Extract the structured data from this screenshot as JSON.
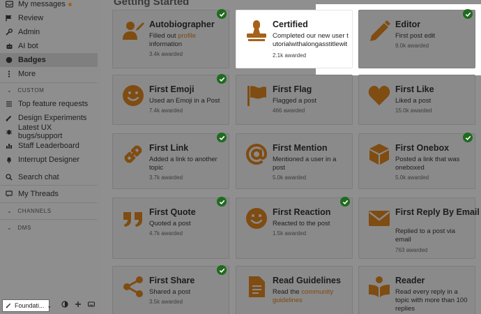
{
  "colors": {
    "accent": "#a7611a",
    "badge_icon": "#7f4c12",
    "check": "#1f6b1f"
  },
  "sidebar": {
    "items": [
      {
        "label": "My messages",
        "icon": "inbox-icon",
        "has_dot": true
      },
      {
        "label": "Review",
        "icon": "flag-icon"
      },
      {
        "label": "Admin",
        "icon": "wrench-icon"
      },
      {
        "label": "AI bot",
        "icon": "robot-icon"
      },
      {
        "label": "Badges",
        "icon": "certificate-icon",
        "active": true
      },
      {
        "label": "More",
        "icon": "more-vertical-icon"
      }
    ],
    "custom_header": "CUSTOM",
    "custom_items": [
      {
        "label": "Top feature requests",
        "icon": "list-icon"
      },
      {
        "label": "Design Experiments",
        "icon": "paint-icon"
      },
      {
        "label": "Latest UX bugs/support",
        "icon": "bug-icon"
      },
      {
        "label": "Staff Leaderboard",
        "icon": "chart-icon"
      },
      {
        "label": "Interrupt Designer",
        "icon": "bell-icon"
      }
    ],
    "search_chat": "Search chat",
    "my_threads": "My Threads",
    "channels_header": "CHANNELS",
    "dms_header": "DMS",
    "footer": {
      "theme_label": "Foundati..."
    }
  },
  "main": {
    "title": "Getting Started",
    "badges": [
      {
        "name": "Autobiographer",
        "desc_before": "Filled out ",
        "desc_link": "profile",
        "desc_after": " information",
        "count": "3.4k awarded"
      },
      {
        "name": "Certified",
        "desc": "Completed our new user tutorialwithalongasstitlewithou",
        "count": "2.1k awarded"
      },
      {
        "name": "Editor",
        "desc": "First post edit",
        "count": "9.0k awarded"
      },
      {
        "name": "First Emoji",
        "desc": "Used an Emoji in a Post",
        "count": "7.4k awarded"
      },
      {
        "name": "First Flag",
        "desc": "Flagged a post",
        "count": "466 awarded"
      },
      {
        "name": "First Like",
        "desc": "Liked a post",
        "count": "15.0k awarded"
      },
      {
        "name": "First Link",
        "desc": "Added a link to another topic",
        "count": "3.7k awarded"
      },
      {
        "name": "First Mention",
        "desc": "Mentioned a user in a post",
        "count": "5.0k awarded"
      },
      {
        "name": "First Onebox",
        "desc": "Posted a link that was oneboxed",
        "count": "5.0k awarded"
      },
      {
        "name": "First Quote",
        "desc": "Quoted a post",
        "count": "4.7k awarded"
      },
      {
        "name": "First Reaction",
        "desc": "Reacted to the post",
        "count": "1.5k awarded"
      },
      {
        "name": "First Reply By Email",
        "desc": "Replied to a post via email",
        "count": "763 awarded"
      },
      {
        "name": "First Share",
        "desc": "Shared a post",
        "count": "3.5k awarded"
      },
      {
        "name": "Read Guidelines",
        "desc_before": "Read the ",
        "desc_link": "community guidelines",
        "desc_after": "",
        "count": ""
      },
      {
        "name": "Reader",
        "desc": "Read every reply in a topic with more than 100 replies",
        "count": ""
      }
    ]
  }
}
